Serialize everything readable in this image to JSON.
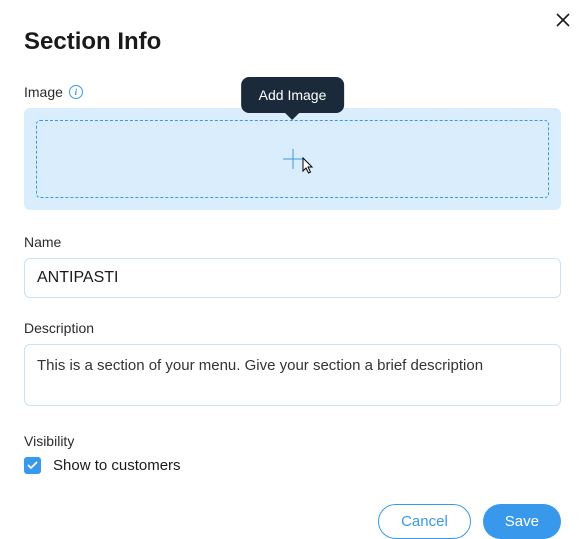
{
  "dialog": {
    "title": "Section Info"
  },
  "image": {
    "label": "Image",
    "tooltip": "Add Image"
  },
  "name": {
    "label": "Name",
    "value": "ANTIPASTI"
  },
  "description": {
    "label": "Description",
    "value": "This is a section of your menu. Give your section a brief description"
  },
  "visibility": {
    "label": "Visibility",
    "checkbox_label": "Show to customers",
    "checked": true
  },
  "buttons": {
    "cancel": "Cancel",
    "save": "Save"
  },
  "colors": {
    "accent": "#3899ec",
    "dropzone_bg": "#daedfd",
    "tooltip_bg": "#1a2a3a"
  }
}
